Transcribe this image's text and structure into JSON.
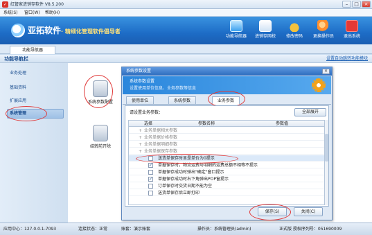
{
  "window": {
    "title": "红管家进销存软件 V8.5.200",
    "min": "–",
    "max": "□",
    "close": "×"
  },
  "menu": [
    "系统(S)",
    "窗口(W)",
    "帮助(H)"
  ],
  "brand": {
    "name": "亚拓软件",
    "slogan": "· 精细化管理软件倡导者"
  },
  "toolbar": [
    {
      "icon": "monitor-icon",
      "label": "功能导航器",
      "color": "#7ec8ff"
    },
    {
      "icon": "book-icon",
      "label": "进销存网校",
      "color": "#ffffff"
    },
    {
      "icon": "lock-icon",
      "label": "修改密码",
      "color": "#f4c23c"
    },
    {
      "icon": "user-swap-icon",
      "label": "更换操作员",
      "color": "#ff9a3c"
    },
    {
      "icon": "power-icon",
      "label": "退出系统",
      "color": "#e53935"
    }
  ],
  "tab_home": "功能导航器",
  "nav": {
    "title": "功能导航栏",
    "right_link": "设置自动跳转功能模块"
  },
  "sidebar": [
    "业务处理",
    "基础资料",
    "扩展应用",
    "系统管理"
  ],
  "tools": [
    {
      "icon": "db-settings-icon",
      "label": "系统参数配置"
    },
    {
      "icon": "db-clear-icon",
      "label": "结转前开除"
    }
  ],
  "dialog": {
    "title": "系统参数设置",
    "close": "×",
    "head_title": "系统参数设置",
    "head_desc": "设置使用单位信息、业务参数等信息",
    "tabs": [
      "使用单位",
      "系统参数",
      "业务参数"
    ],
    "question": "请设置业务参数：",
    "expand_all": "全部展开",
    "columns": [
      "选择",
      "参数名称",
      "参数值"
    ],
    "rows": [
      {
        "type": "group",
        "text": "业务单据相关参数"
      },
      {
        "type": "group",
        "text": "业务单据价格参数"
      },
      {
        "type": "group",
        "text": "业务单据明细参数"
      },
      {
        "type": "group",
        "text": "业务单据保存参数"
      },
      {
        "type": "item",
        "checked": false,
        "text": "送货单保存时显是单价为0提示",
        "selected": true
      },
      {
        "type": "item",
        "checked": true,
        "text": "单据保存时，物流运费与明细的运费总额不相等不提示"
      },
      {
        "type": "item",
        "checked": false,
        "text": "单据保存成功时弹出\"确定\"窗口提示"
      },
      {
        "type": "item",
        "checked": true,
        "text": "单据保存成功时右下角弹出POP窗提示"
      },
      {
        "type": "item",
        "checked": false,
        "text": "订单保存时交货日期不能为空"
      },
      {
        "type": "item",
        "checked": false,
        "text": "送货单保存后立即打印"
      }
    ],
    "save": "保存(S)",
    "cancel": "关闭(C)"
  },
  "status": {
    "center": "应用中心：127.0.0.1-7093",
    "conn": "连接状态：正常",
    "account": "账套：演示账套",
    "operator": "操作员：系统管理员(admin)",
    "edition": "正式版 授权序列号：051690009"
  }
}
